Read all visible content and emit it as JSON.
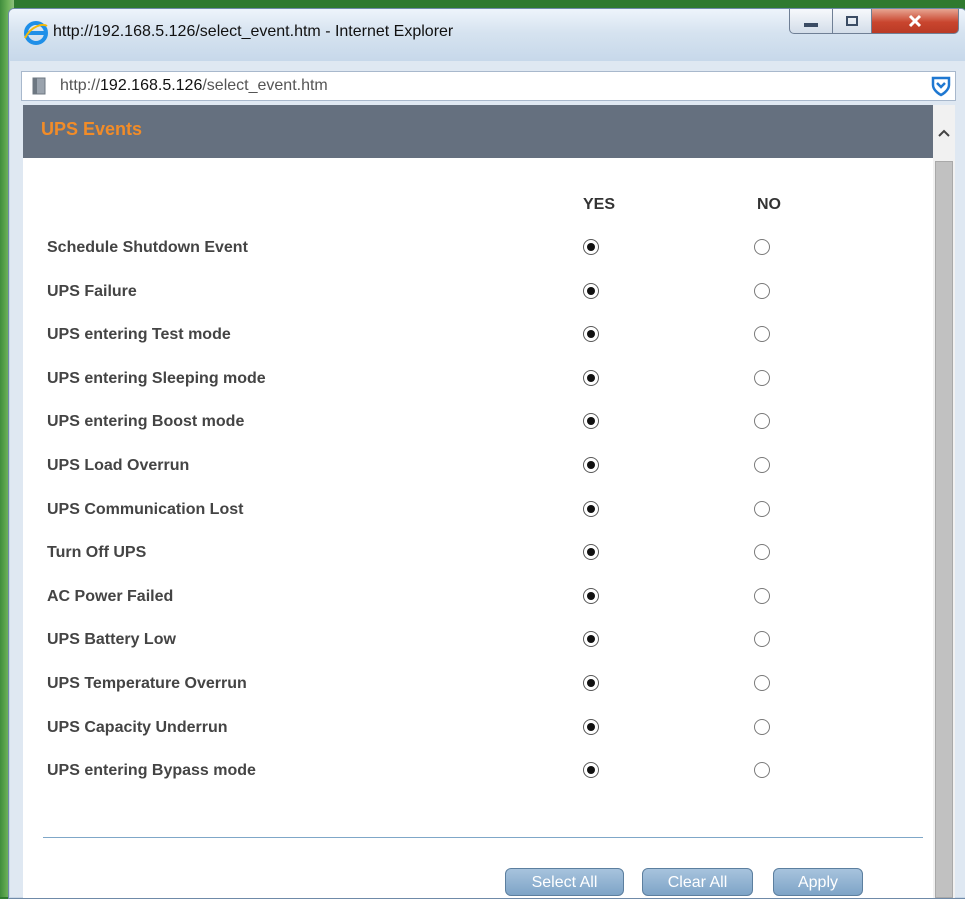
{
  "browser": {
    "window_title": "http://192.168.5.126/select_event.htm - Internet Explorer",
    "address_prefix": "http://",
    "address_host": "192.168.5.126",
    "address_path": "/select_event.htm"
  },
  "page": {
    "title": "UPS Events",
    "title_color": "#f28c28",
    "header_bg": "#65707f",
    "columns": {
      "yes": "YES",
      "no": "NO"
    },
    "events": [
      {
        "label": "Schedule Shutdown Event",
        "selected": "YES"
      },
      {
        "label": "UPS Failure",
        "selected": "YES"
      },
      {
        "label": "UPS entering Test mode",
        "selected": "YES"
      },
      {
        "label": "UPS entering Sleeping mode",
        "selected": "YES"
      },
      {
        "label": "UPS entering Boost mode",
        "selected": "YES"
      },
      {
        "label": "UPS Load Overrun",
        "selected": "YES"
      },
      {
        "label": "UPS Communication Lost",
        "selected": "YES"
      },
      {
        "label": "Turn Off UPS",
        "selected": "YES"
      },
      {
        "label": "AC Power Failed",
        "selected": "YES"
      },
      {
        "label": "UPS Battery Low",
        "selected": "YES"
      },
      {
        "label": "UPS Temperature Overrun",
        "selected": "YES"
      },
      {
        "label": "UPS Capacity Underrun",
        "selected": "YES"
      },
      {
        "label": "UPS entering Bypass mode",
        "selected": "YES"
      }
    ],
    "buttons": {
      "select_all": "Select All",
      "clear_all": "Clear All",
      "apply": "Apply"
    }
  }
}
